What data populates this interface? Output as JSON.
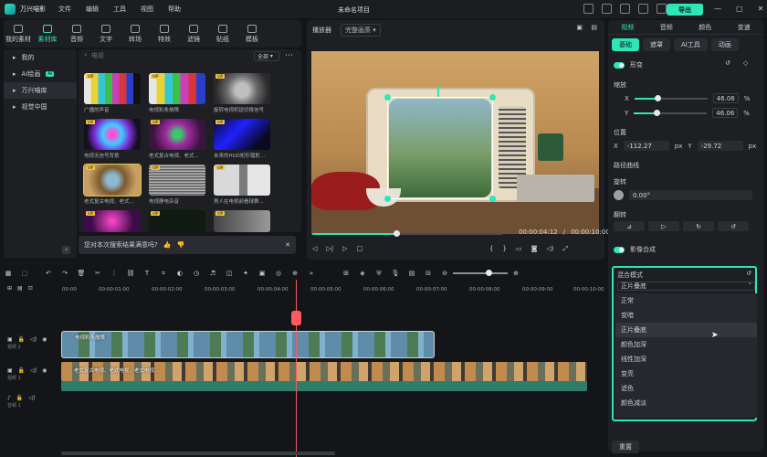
{
  "titlebar": {
    "app": "万兴喵影",
    "menus": [
      "文件",
      "编辑",
      "工具",
      "视图",
      "帮助"
    ],
    "project": "未命名项目",
    "export": "导出"
  },
  "library": {
    "tabs": [
      "我的素材",
      "素材库",
      "音频",
      "文字",
      "转场",
      "特效",
      "滤镜",
      "贴纸",
      "模板"
    ],
    "active_tab": "素材库",
    "sidebar": [
      {
        "label": "我的"
      },
      {
        "label": "AI绘画",
        "badge": "AI"
      },
      {
        "label": "万兴喵库"
      },
      {
        "label": "视觉中国"
      }
    ],
    "search_placeholder": "电视",
    "filter": "全部",
    "items": [
      "广播的声音",
      "电视彩条故障",
      "旋转电视机钮切换信号",
      "电视无信号背景",
      "老式复古电视、老式...",
      "未来的HUD矩形镭射...",
      "老式复古电视、老式...",
      "电视静电杂音",
      "男人在电视前看球赛..."
    ],
    "feedback": "您对本次搜索结果满意吗?"
  },
  "player": {
    "label": "播放器",
    "quality": "完整画质",
    "time_current": "00:00:04:12",
    "time_sep": "/",
    "time_total": "00:00:10:00",
    "progress": 0.44
  },
  "properties": {
    "tabs": [
      "视频",
      "音频",
      "颜色",
      "变速"
    ],
    "subtabs": [
      "基础",
      "遮罩",
      "AI工具",
      "动画"
    ],
    "transform": "形变",
    "scale": "缩放",
    "x_label": "X",
    "y_label": "Y",
    "scale_x": "46.06",
    "scale_y": "46.06",
    "pct": "%",
    "position": "位置",
    "pos_x": "-112.27",
    "pos_y": "-29.72",
    "px": "px",
    "path_curve": "路径曲线",
    "rotate": "旋转",
    "rotate_val": "0.00°",
    "flip": "翻转",
    "compositing": "影像合成",
    "blend_mode": "混合模式",
    "blend_value": "正片叠底",
    "blend_options": [
      "正常",
      "变暗",
      "正片叠底",
      "颜色加深",
      "线性加深",
      "变亮",
      "滤色",
      "颜色减淡"
    ],
    "reset": "重置"
  },
  "timeline": {
    "ticks": [
      "00:00",
      "00:00:01:00",
      "00:00:02:00",
      "00:00:03:00",
      "00:00:04:00",
      "00:00:05:00",
      "00:00:06:00",
      "00:00:07:00",
      "00:00:08:00",
      "00:00:09:00",
      "00:00:10:00"
    ],
    "track_video2": "视频 2",
    "track_video1": "视频 1",
    "track_audio1": "音频 1",
    "clip1": "电视彩条故障",
    "clip2": "老式复古电视、老式电视、老式电视..."
  },
  "colors": {
    "accent": "#2ee6b6",
    "playhead": "#ff5a5f"
  }
}
